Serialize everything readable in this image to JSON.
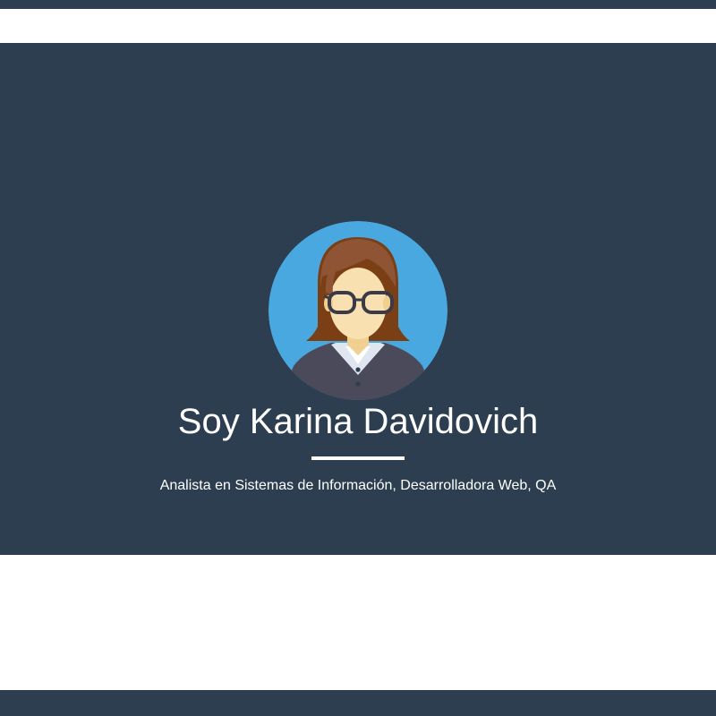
{
  "hero": {
    "title": "Soy Karina Davidovich",
    "subtitle": "Analista en Sistemas de Información, Desarrolladora Web, QA",
    "avatar_icon": "woman-with-glasses-avatar-icon"
  },
  "colors": {
    "primary_dark": "#2c3e50",
    "avatar_background": "#4aa8e0",
    "text": "#ffffff"
  }
}
